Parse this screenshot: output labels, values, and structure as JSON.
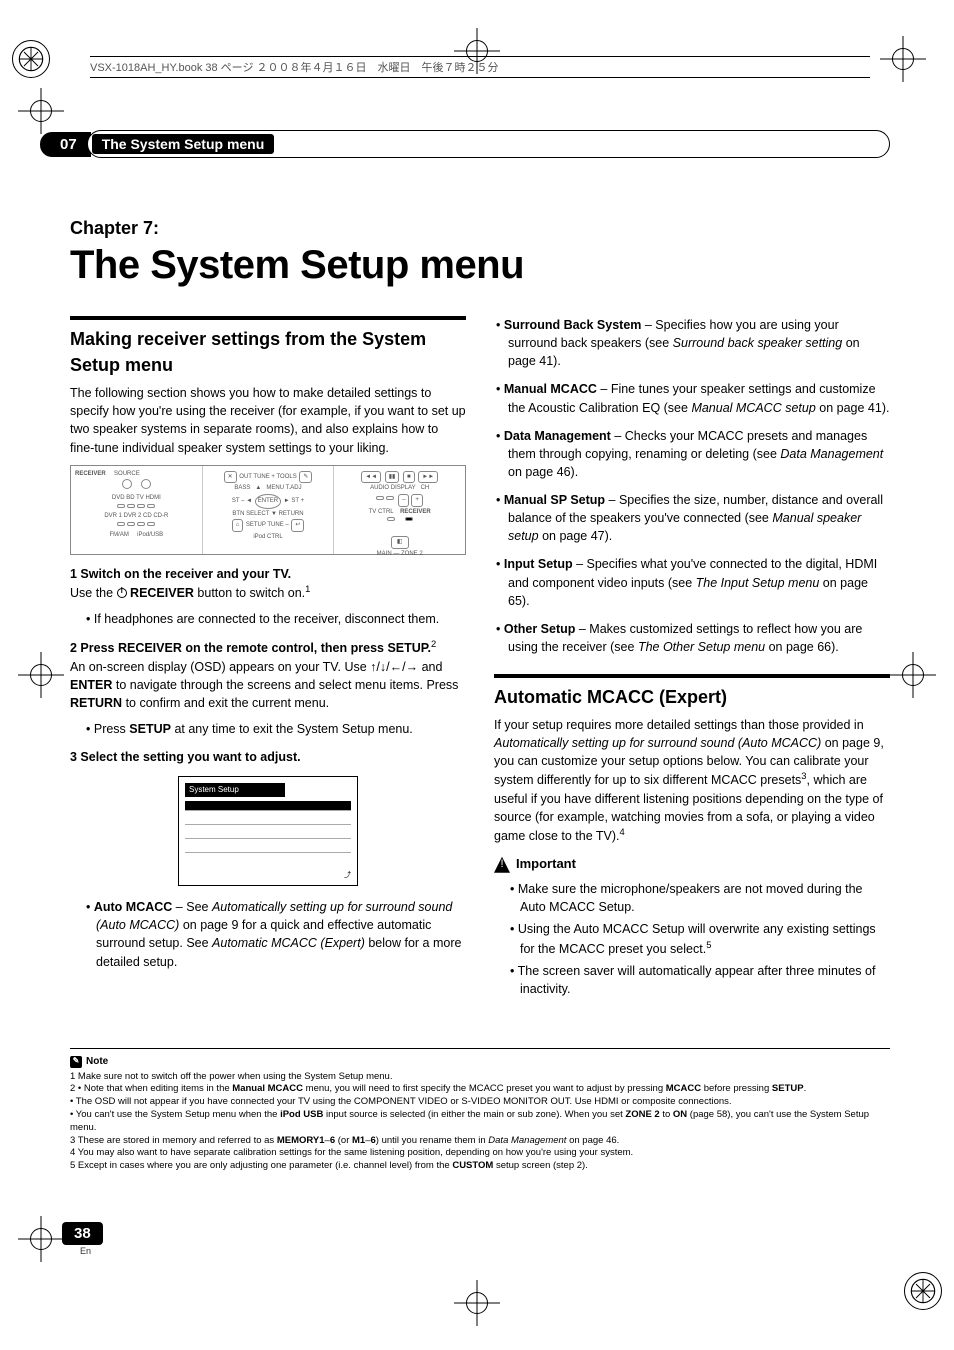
{
  "book_header": "VSX-1018AH_HY.book  38 ページ  ２００８年４月１６日　水曜日　午後７時２５分",
  "section_number": "07",
  "section_tab_title": "The System Setup menu",
  "chapter_label": "Chapter 7:",
  "chapter_title": "The System Setup menu",
  "left": {
    "h2": "Making receiver settings from the System Setup menu",
    "intro": "The following section shows you how to make detailed settings to specify how you're using the receiver (for example, if you want to set up two speaker systems in separate rooms), and also explains how to fine-tune individual speaker system settings to your liking.",
    "step1": "1    Switch on the receiver and your TV.",
    "step1_body_a": "Use the ",
    "step1_body_b": " RECEIVER",
    "step1_body_c": " button to switch on.",
    "step1_sup": "1",
    "step1_bullet": "If headphones are connected to the receiver, disconnect them.",
    "step2": "2    Press RECEIVER on the remote control, then press SETUP.",
    "step2_sup": "2",
    "osd_para_a": "An on-screen display (OSD) appears on your TV. Use ",
    "osd_para_b": " and ",
    "osd_para_c": "ENTER",
    "osd_para_d": " to navigate through the screens and select menu items. Press ",
    "osd_para_e": "RETURN",
    "osd_para_f": " to confirm and exit the current menu.",
    "osd_bullet_a": "Press ",
    "osd_bullet_b": "SETUP",
    "osd_bullet_c": " at any time to exit the System Setup menu.",
    "step3": "3    Select the setting you want to adjust.",
    "auto_mcacc_a": "Auto MCACC",
    "auto_mcacc_b": " – See ",
    "auto_mcacc_c": "Automatically setting up for surround sound (Auto MCACC)",
    "auto_mcacc_d": " on page 9 for a quick and effective automatic surround setup. See ",
    "auto_mcacc_e": "Automatic MCACC (Expert)",
    "auto_mcacc_f": " below for a more detailed setup."
  },
  "right": {
    "items": [
      {
        "b": "Surround Back System",
        "t1": " – Specifies how you are using your surround back speakers (see ",
        "i": "Surround back speaker setting",
        "t2": " on page 41)."
      },
      {
        "b": "Manual MCACC",
        "t1": " – Fine tunes your speaker settings and customize the Acoustic Calibration EQ (see ",
        "i": "Manual MCACC setup",
        "t2": " on page 41)."
      },
      {
        "b": "Data Management",
        "t1": " – Checks your MCACC presets and manages them through copying, renaming or deleting (see ",
        "i": "Data Management",
        "t2": " on page 46)."
      },
      {
        "b": "Manual SP Setup",
        "t1": " – Specifies the size, number, distance and overall balance of the speakers you've connected (see ",
        "i": "Manual speaker setup",
        "t2": " on page 47)."
      },
      {
        "b": "Input Setup",
        "t1": " – Specifies what you've connected to the digital, HDMI and component video inputs (see ",
        "i": "The Input Setup menu",
        "t2": " on page 65)."
      },
      {
        "b": "Other Setup",
        "t1": " – Makes customized settings to reflect how you are using the receiver (see ",
        "i": "The Other Setup menu",
        "t2": " on page 66)."
      }
    ],
    "h2": "Automatic MCACC (Expert)",
    "p1_a": "If your setup requires more detailed settings than those provided in ",
    "p1_b": "Automatically setting up for surround sound (Auto MCACC)",
    "p1_c": " on page 9, you can customize your setup options below. You can calibrate your system differently for up to six different MCACC presets",
    "p1_sup3": "3",
    "p1_d": ", which are useful if you have different listening positions depending on the type of source (for example, watching movies from a sofa, or playing a video game close to the TV).",
    "p1_sup4": "4",
    "important": "Important",
    "imp1": "Make sure the microphone/speakers are not moved during the Auto MCACC Setup.",
    "imp2_a": "Using the Auto MCACC Setup will overwrite any existing settings for the MCACC preset you select.",
    "imp2_sup": "5",
    "imp3": "The screen saver will automatically appear after three minutes of inactivity."
  },
  "remote": {
    "receiver": "RECEIVER",
    "source": "SOURCE",
    "dvd": "DVD",
    "bd": "BD",
    "tv": "TV",
    "hdmi": "HDMI",
    "dvr1": "DVR 1",
    "dvr2": "DVR 2",
    "cd": "CD",
    "cdr": "CD-R",
    "fmam": "FM/AM",
    "ipod": "iPod/USB",
    "out": "OUT",
    "tunep": "TUNE +",
    "tools": "TOOLS",
    "bass": "BASS",
    "enter": "ENTER",
    "menu": "MENU",
    "tadj": "T.ADJ",
    "stm": "ST –",
    "stp": "ST +",
    "btn": "BTN",
    "setup": "SETUP",
    "tunem": "TUNE –",
    "return": "RETURN",
    "select": "SELECT",
    "ipodctrl": "iPod CTRL",
    "prev": "◄◄",
    "pause": "▮▮",
    "stop": "■",
    "next": "►►",
    "audio": "AUDIO",
    "display": "DISPLAY",
    "ch": "CH",
    "minus": "–",
    "plus": "+",
    "tvctrl": "TV CTRL",
    "receiver2": "RECEIVER",
    "main": "MAIN",
    "zone2": "ZONE 2"
  },
  "osd": {
    "title": "System Setup",
    "foot": "⤴"
  },
  "footnotes": {
    "label": "Note",
    "n1": "1 Make sure not to switch off the power when using the System Setup menu.",
    "n2a": "2 • Note that when editing items in the ",
    "n2b": "Manual MCACC",
    "n2c": " menu, you will need to first specify the MCACC preset you want to adjust by pressing ",
    "n2d": "MCACC",
    "n2e": " before pressing ",
    "n2f": "SETUP",
    "n2g": ".",
    "n2h": " • The OSD will not appear if you have connected your TV using the COMPONENT VIDEO or S-VIDEO MONITOR OUT. Use HDMI or composite connections.",
    "n2i": " • You can't use the System Setup menu when the ",
    "n2j": "iPod USB",
    "n2k": " input source is selected (in either the main or sub zone). When you set ",
    "n2l": "ZONE 2",
    "n2m": " to ",
    "n2n": "ON",
    "n2o": " (page 58), you can't use the System Setup menu.",
    "n3a": "3 These are stored in memory and referred to as ",
    "n3b": "MEMORY1",
    "n3c": "–",
    "n3d": "6",
    "n3e": " (or ",
    "n3f": "M1",
    "n3g": "–",
    "n3h": "6",
    "n3i": ") until you rename them in ",
    "n3j": "Data Management",
    "n3k": " on page 46.",
    "n4": "4 You may also want to have separate calibration settings for the same listening position, depending on how you're using your system.",
    "n5a": "5 Except in cases where you are only adjusting one parameter (i.e. channel level) from the ",
    "n5b": "CUSTOM",
    "n5c": " setup screen (step 2)."
  },
  "page_number": "38",
  "page_lang": "En"
}
